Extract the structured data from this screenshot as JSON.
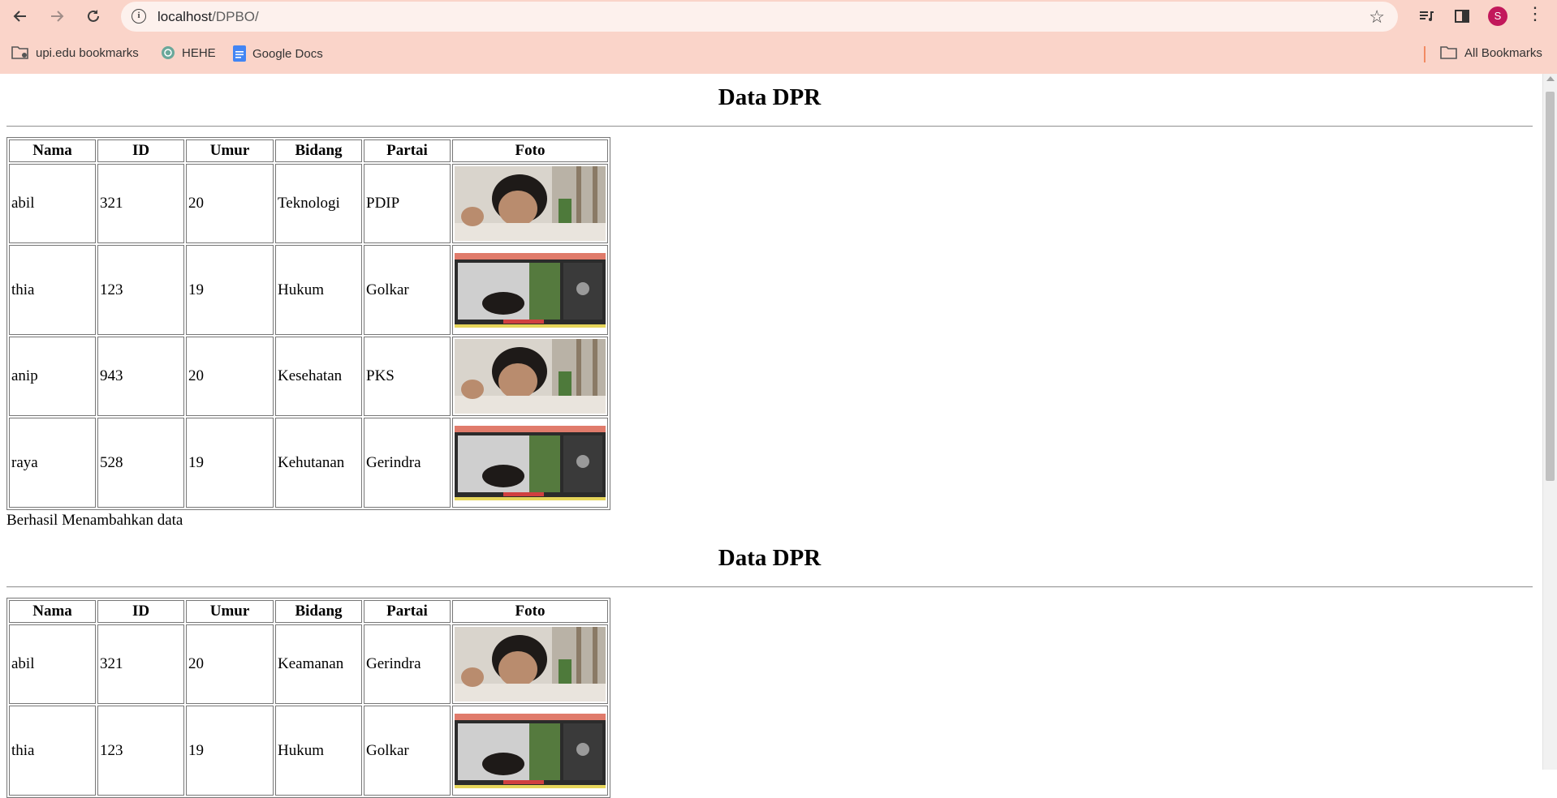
{
  "browser": {
    "url_host": "localhost",
    "url_path": "/DPBO/",
    "avatar_initial": "S",
    "bookmarks": [
      {
        "label": "upi.edu bookmarks",
        "icon": "folder-icon"
      },
      {
        "label": "HEHE",
        "icon": "openai-icon"
      },
      {
        "label": "Google Docs",
        "icon": "google-docs-icon"
      }
    ],
    "all_bookmarks": "All Bookmarks"
  },
  "sections": [
    {
      "title": "Data DPR",
      "headers": [
        "Nama",
        "ID",
        "Umur",
        "Bidang",
        "Partai",
        "Foto"
      ],
      "rows": [
        {
          "nama": "abil",
          "id": "321",
          "umur": "20",
          "bidang": "Teknologi",
          "partai": "PDIP",
          "foto": "portrait-photo"
        },
        {
          "nama": "thia",
          "id": "123",
          "umur": "19",
          "bidang": "Hukum",
          "partai": "Golkar",
          "foto": "screenshot-photo"
        },
        {
          "nama": "anip",
          "id": "943",
          "umur": "20",
          "bidang": "Kesehatan",
          "partai": "PKS",
          "foto": "portrait-photo"
        },
        {
          "nama": "raya",
          "id": "528",
          "umur": "19",
          "bidang": "Kehutanan",
          "partai": "Gerindra",
          "foto": "screenshot-photo"
        }
      ],
      "message": "Berhasil Menambahkan data"
    },
    {
      "title": "Data DPR",
      "headers": [
        "Nama",
        "ID",
        "Umur",
        "Bidang",
        "Partai",
        "Foto"
      ],
      "rows": [
        {
          "nama": "abil",
          "id": "321",
          "umur": "20",
          "bidang": "Keamanan",
          "partai": "Gerindra",
          "foto": "portrait-photo"
        },
        {
          "nama": "thia",
          "id": "123",
          "umur": "19",
          "bidang": "Hukum",
          "partai": "Golkar",
          "foto": "screenshot-photo"
        }
      ]
    }
  ]
}
